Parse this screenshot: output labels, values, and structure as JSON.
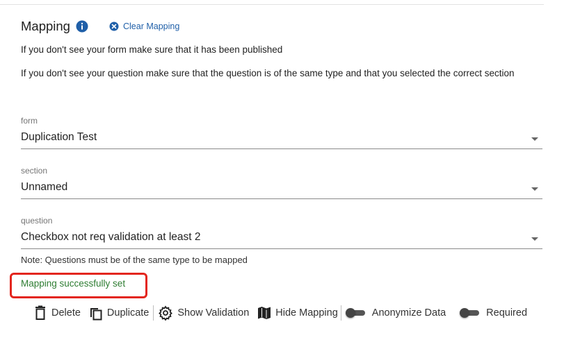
{
  "mapping": {
    "title": "Mapping",
    "clear_label": "Clear Mapping",
    "help": [
      "If you don't see your form make sure that it has been published",
      "If you don't see your question make sure that the question is of the same type and that you selected the correct section"
    ]
  },
  "fields": {
    "form": {
      "label": "form",
      "value": "Duplication Test"
    },
    "section": {
      "label": "section",
      "value": "Unnamed"
    },
    "question": {
      "label": "question",
      "value": "Checkbox not req validation at least 2"
    }
  },
  "note": "Note: Questions must be of the same type to be mapped",
  "status": {
    "text": "Mapping successfully set",
    "color": "#2e7d32",
    "highlight_color": "#e3261e"
  },
  "toolbar": {
    "delete": "Delete",
    "duplicate": "Duplicate",
    "show_validation": "Show Validation",
    "hide_mapping": "Hide Mapping",
    "anonymize": "Anonymize Data",
    "required": "Required",
    "anonymize_on": false,
    "required_on": false
  },
  "icons": [
    "info-icon",
    "close-circle-icon",
    "trash-icon",
    "copy-icon",
    "gear-icon",
    "map-icon",
    "dropdown-arrow-icon"
  ],
  "colors": {
    "accent": "#1f5fa8",
    "success": "#2e7d32",
    "highlight": "#e3261e"
  }
}
